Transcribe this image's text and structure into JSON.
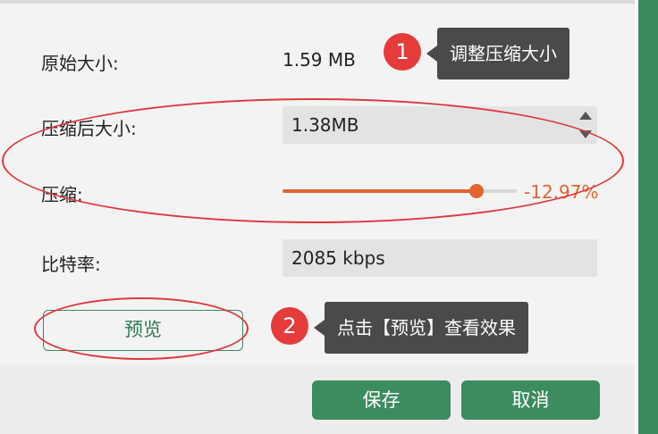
{
  "form": {
    "original_size_label": "原始大小:",
    "original_size_value": "1.59 MB",
    "compressed_size_label": "压缩后大小:",
    "compressed_size_value": "1.38MB",
    "compression_label": "压缩:",
    "compression_percent": "-12.97%",
    "slider_fraction": 0.83,
    "bitrate_label": "比特率:",
    "bitrate_value": "2085 kbps"
  },
  "buttons": {
    "preview": "预览",
    "save": "保存",
    "cancel": "取消"
  },
  "annotations": {
    "step1_number": "1",
    "step1_text": "调整压缩大小",
    "step2_number": "2",
    "step2_text": "点击【预览】查看效果"
  },
  "colors": {
    "accent_green": "#3d8c60",
    "slider_orange": "#e0652f",
    "annotation_red": "#e53b3b"
  },
  "icons": [
    "spin-up-icon",
    "spin-down-icon"
  ]
}
